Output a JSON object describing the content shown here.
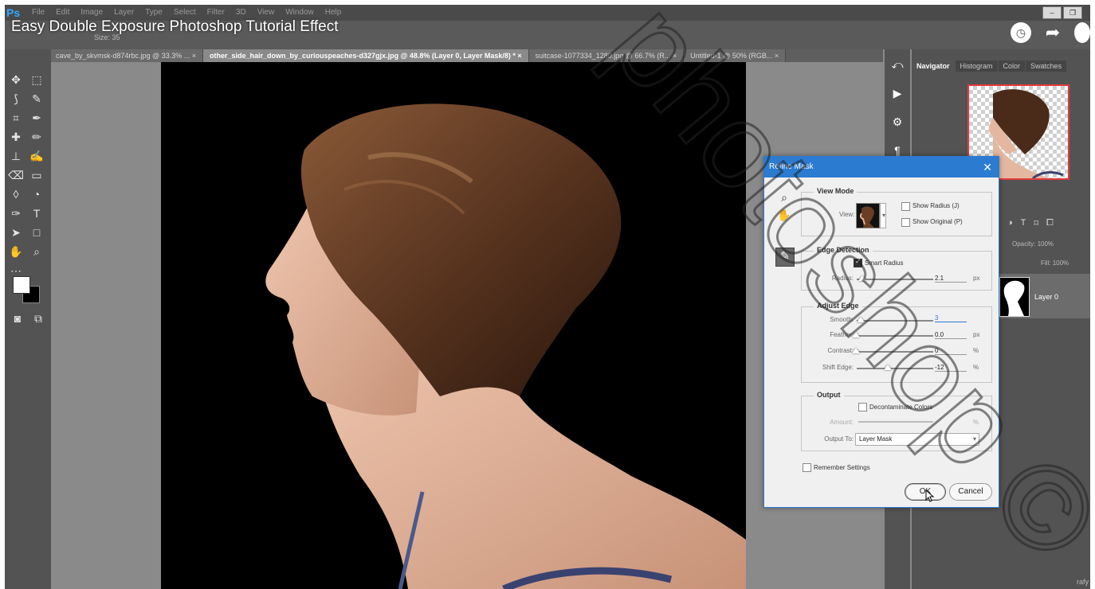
{
  "video": {
    "title": "Easy Double Exposure Photoshop Tutorial Effect"
  },
  "app": {
    "logo": "Ps",
    "menu": [
      "File",
      "Edit",
      "Image",
      "Layer",
      "Type",
      "Select",
      "Filter",
      "3D",
      "View",
      "Window",
      "Help"
    ],
    "options_size_label": "Size:",
    "options_size_value": "35"
  },
  "tabs": [
    {
      "label": "cave_by_skvmsk-d874rbc.jpg @ 33.3% ... ×",
      "active": false
    },
    {
      "label": "other_side_hair_down_by_curiouspeaches-d327gjx.jpg @ 48.8% (Layer 0, Layer Mask/8) * ×",
      "active": true
    },
    {
      "label": "suitcase-1077334_1280.jpg @ 66.7% (R... ×",
      "active": false
    },
    {
      "label": "Untitled-1 @ 50% (RGB... ×",
      "active": false
    }
  ],
  "panels": {
    "tabs": [
      "Navigator",
      "Histogram",
      "Color",
      "Swatches"
    ],
    "layers": {
      "opacity_label": "Opacity:",
      "opacity_value": "100%",
      "fill_label": "Fill:",
      "fill_value": "100%",
      "layer_name": "Layer 0"
    }
  },
  "dialog": {
    "title": "Refine Mask",
    "close": "✕",
    "view_mode": {
      "heading": "View Mode",
      "view_label": "View:",
      "show_radius": "Show Radius (J)",
      "show_original": "Show Original (P)"
    },
    "edge_detection": {
      "heading": "Edge Detection",
      "smart_radius": "Smart Radius",
      "smart_radius_checked": true,
      "radius_label": "Radius:",
      "radius_value": "2.1",
      "radius_unit": "px"
    },
    "adjust_edge": {
      "heading": "Adjust Edge",
      "smooth_label": "Smooth:",
      "smooth_value": "3",
      "feather_label": "Feather:",
      "feather_value": "0.0",
      "feather_unit": "px",
      "contrast_label": "Contrast:",
      "contrast_value": "0",
      "contrast_unit": "%",
      "shift_label": "Shift Edge:",
      "shift_value": "-12",
      "shift_unit": "%"
    },
    "output": {
      "heading": "Output",
      "decontaminate": "Decontaminate Colors",
      "amount_label": "Amount:",
      "amount_unit": "%",
      "output_to_label": "Output To:",
      "output_to_value": "Layer Mask"
    },
    "remember": "Remember Settings",
    "ok": "OK",
    "cancel": "Cancel"
  },
  "watermark": "photoshop ©",
  "colors": {
    "accent": "#2b7bd1",
    "nav_frame": "#e23b3b",
    "ps_blue": "#31a8ff"
  }
}
